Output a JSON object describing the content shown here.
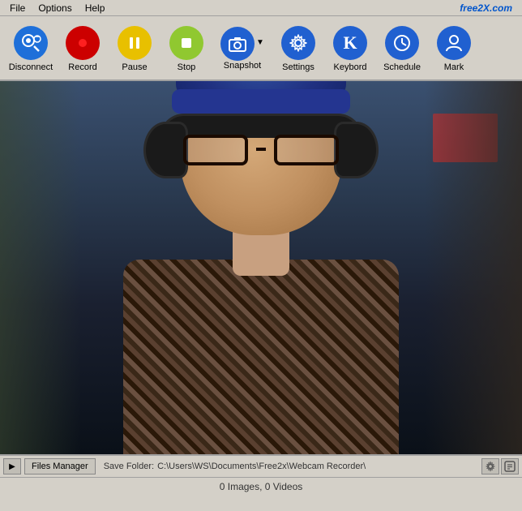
{
  "app": {
    "brand": "free2X.com",
    "menu": {
      "items": [
        "File",
        "Options",
        "Help"
      ]
    }
  },
  "toolbar": {
    "buttons": [
      {
        "id": "disconnect",
        "label": "Disconnect",
        "icon": "disconnect-icon"
      },
      {
        "id": "record",
        "label": "Record",
        "icon": "record-icon"
      },
      {
        "id": "pause",
        "label": "Pause",
        "icon": "pause-icon"
      },
      {
        "id": "stop",
        "label": "Stop",
        "icon": "stop-icon"
      },
      {
        "id": "snapshot",
        "label": "Snapshot",
        "icon": "snapshot-icon"
      },
      {
        "id": "settings",
        "label": "Settings",
        "icon": "settings-icon"
      },
      {
        "id": "keyboard",
        "label": "Keybord",
        "icon": "keyboard-icon"
      },
      {
        "id": "schedule",
        "label": "Schedule",
        "icon": "schedule-icon"
      },
      {
        "id": "mark",
        "label": "Mark",
        "icon": "mark-icon"
      }
    ]
  },
  "statusbar": {
    "files_manager": "Files Manager",
    "save_folder_label": "Save Folder:",
    "save_folder_path": "C:\\Users\\WS\\Documents\\Free2x\\Webcam Recorder\\"
  },
  "infobar": {
    "text": "0 Images, 0 Videos"
  }
}
